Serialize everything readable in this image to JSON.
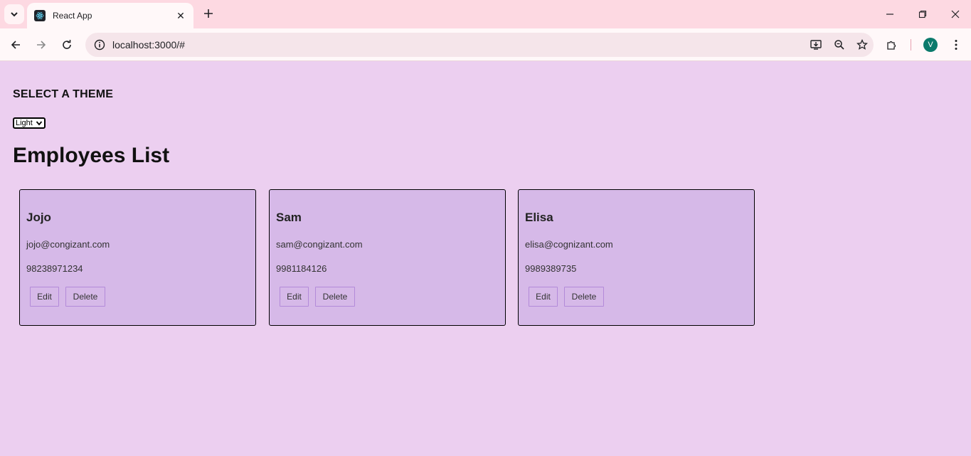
{
  "browser": {
    "tab_title": "React App",
    "url": "localhost:3000/#",
    "profile_initial": "V"
  },
  "page": {
    "theme_heading": "SELECT A THEME",
    "theme_selected": "Light",
    "list_title": "Employees List"
  },
  "employees": [
    {
      "name": "Jojo",
      "email": "jojo@congizant.com",
      "phone": "98238971234",
      "edit_label": "Edit",
      "delete_label": "Delete"
    },
    {
      "name": "Sam",
      "email": "sam@congizant.com",
      "phone": "9981184126",
      "edit_label": "Edit",
      "delete_label": "Delete"
    },
    {
      "name": "Elisa",
      "email": "elisa@cognizant.com",
      "phone": "9989389735",
      "edit_label": "Edit",
      "delete_label": "Delete"
    }
  ],
  "colors": {
    "page_bg": "#eccff0",
    "card_bg": "#d6b9e8",
    "button_border": "#b38ad9"
  }
}
